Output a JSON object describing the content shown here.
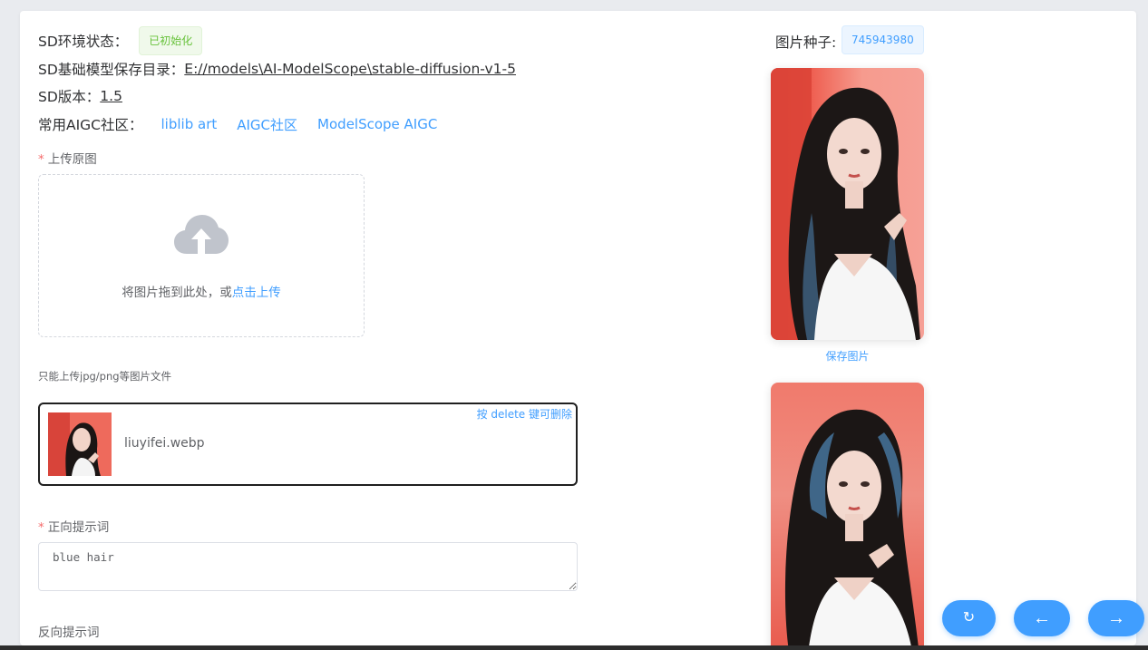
{
  "env": {
    "status_label": "SD环境状态：",
    "status_value": "已初始化",
    "model_dir_label": "SD基础模型保存目录：",
    "model_dir_value": "E://models\\AI-ModelScope\\stable-diffusion-v1-5",
    "version_label": "SD版本：",
    "version_value": "1.5",
    "community_label": "常用AIGC社区：",
    "community_links": [
      "liblib art",
      "AIGC社区",
      "ModelScope AIGC"
    ]
  },
  "form": {
    "upload_label": "上传原图",
    "upload_hint": "将图片拖到此处，或",
    "upload_hint_link": "点击上传",
    "upload_tip": "只能上传jpg/png等图片文件",
    "file_name": "liuyifei.webp",
    "file_delete_hint": "按 delete 键可删除",
    "positive_label": "正向提示词",
    "positive_value": "blue hair",
    "negative_label": "反向提示词"
  },
  "result": {
    "seed_label": "图片种子:",
    "seed_value": "745943980",
    "save_label": "保存图片"
  },
  "fab": {
    "refresh": "↻",
    "back": "←",
    "forward": "→"
  },
  "colors": {
    "accent": "#409eff",
    "success": "#67c23a",
    "required": "#f56c6c"
  }
}
